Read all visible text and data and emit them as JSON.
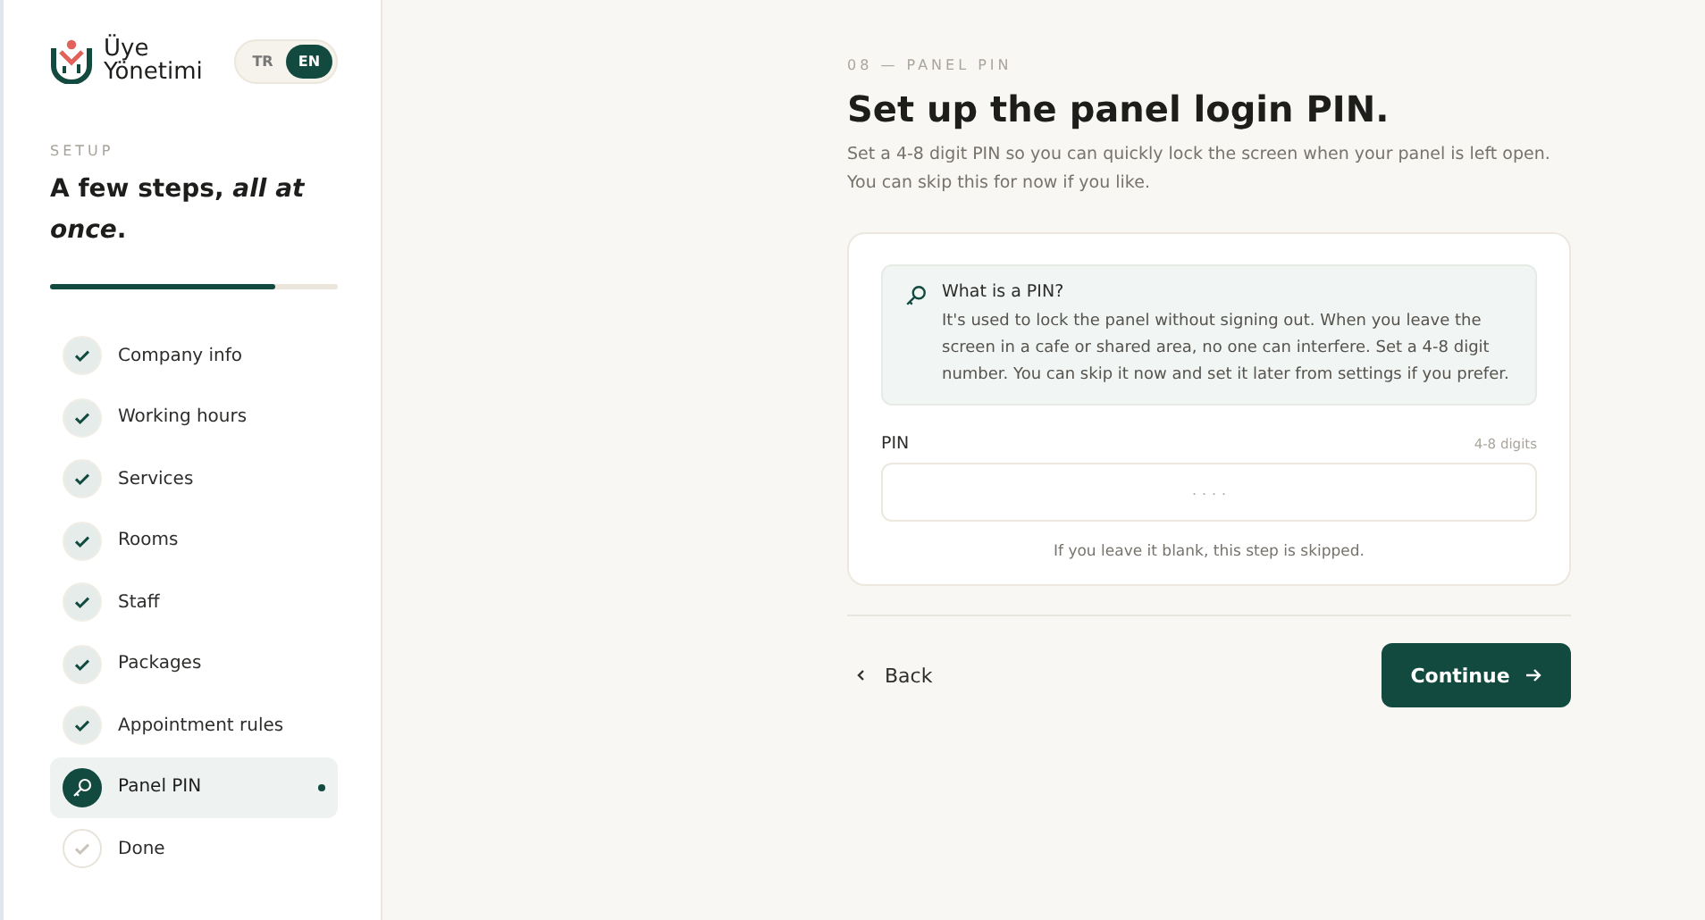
{
  "brand": {
    "name_line1": "Üye",
    "name_line2": "Yönetimi"
  },
  "languages": [
    {
      "label": "TR",
      "selected": false
    },
    {
      "label": "EN",
      "selected": true
    }
  ],
  "setup": {
    "eyebrow": "SETUP",
    "heading": "A few steps, *all at once*.",
    "progress": {
      "level": 0.78
    }
  },
  "steps": [
    {
      "label": "Company info",
      "kind": "done"
    },
    {
      "label": "Working hours",
      "kind": "done"
    },
    {
      "label": "Services",
      "kind": "done"
    },
    {
      "label": "Rooms",
      "kind": "done"
    },
    {
      "label": "Staff",
      "kind": "done"
    },
    {
      "label": "Packages",
      "kind": "done"
    },
    {
      "label": "Appointment rules",
      "kind": "done"
    },
    {
      "label": "Panel PIN",
      "kind": "current"
    },
    {
      "label": "Done",
      "kind": "pending"
    }
  ],
  "page": {
    "eyebrow": "08 — PANEL PIN",
    "title": "Set up the panel login PIN.",
    "subtitle": "Set a 4-8 digit PIN so you can quickly lock the screen when your panel is left open. You can skip this for now if you like."
  },
  "info": {
    "title": "What is a PIN?",
    "text": "It's used to lock the panel without signing out. When you leave the screen in a cafe or shared area, no one can interfere. Set a 4-8 digit number. You can skip it now and set it later from settings if you prefer."
  },
  "pin_field": {
    "label": "PIN",
    "hint": "4-8 digits",
    "placeholder": "· · · ·",
    "note": "If you leave it blank, this step is skipped."
  },
  "buttons": {
    "back": "Back",
    "continue": "Continue"
  }
}
